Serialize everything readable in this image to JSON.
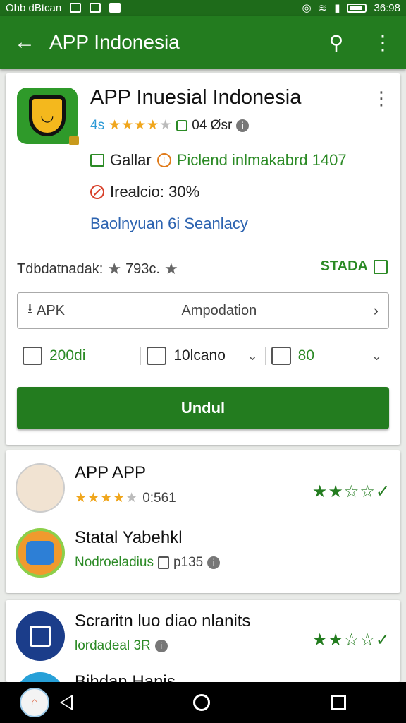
{
  "status_bar": {
    "carrier": "Ohb dBtcan",
    "time": "36:98"
  },
  "app_bar": {
    "title": "APP Indonesia",
    "back_icon": "arrow-left-icon",
    "search_icon": "search-icon",
    "menu_icon": "more-vert-icon"
  },
  "app": {
    "title": "APP Inuesial Indonesia",
    "rating_prefix": "4s",
    "stars": "★★★★",
    "stars_off": "★",
    "downloads": "04 Øsr",
    "line1_left": "Gallar",
    "line1_right": "Piclend inlmakabrd 1407",
    "line2": "Irealcio: 30%",
    "line3": "Baolnyuan 6i Seanlacy",
    "summary_label": "Tdbdatnadak:",
    "summary_value": "793c.",
    "status_label": "STADA",
    "apk_label": "APK",
    "apk_value": "Ampodation",
    "stat1": "200di",
    "stat2": "10lcano",
    "stat3": "80",
    "download_label": "Undul",
    "colors": {
      "primary": "#237c1f",
      "star": "#f0a61c",
      "link": "#2c63b0"
    }
  },
  "related": [
    {
      "name": "APP APP",
      "sub": "0:561",
      "right_stars": "★★☆☆",
      "check": "✓"
    },
    {
      "name": "Statal Yabehkl",
      "sub": "Nodroeladius",
      "sub2": "p135"
    },
    {
      "name": "Scraritn luo diao nlanits",
      "sub": "lordadeal 3R",
      "right_stars": "★★☆☆",
      "check": "✓"
    },
    {
      "name": "Bihdan Hanis"
    }
  ],
  "nav": {
    "back": "back-icon",
    "home": "home-icon",
    "recents": "recents-icon"
  }
}
